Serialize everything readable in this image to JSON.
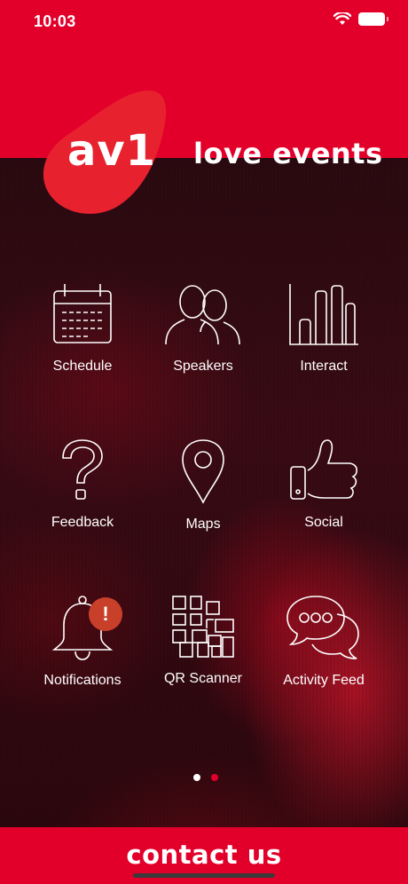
{
  "status_bar": {
    "time": "10:03"
  },
  "brand": {
    "logo_text": "av1",
    "tagline": "love events",
    "color": "#e2002b"
  },
  "menu": [
    {
      "id": "schedule",
      "label": "Schedule",
      "icon": "calendar-icon"
    },
    {
      "id": "speakers",
      "label": "Speakers",
      "icon": "people-icon"
    },
    {
      "id": "interact",
      "label": "Interact",
      "icon": "bar-chart-icon"
    },
    {
      "id": "feedback",
      "label": "Feedback",
      "icon": "question-mark-icon"
    },
    {
      "id": "maps",
      "label": "Maps",
      "icon": "map-pin-icon"
    },
    {
      "id": "social",
      "label": "Social",
      "icon": "thumbs-up-icon"
    },
    {
      "id": "notifications",
      "label": "Notifications",
      "icon": "bell-icon",
      "badge": "!"
    },
    {
      "id": "qr_scanner",
      "label": "QR Scanner",
      "icon": "qr-code-icon"
    },
    {
      "id": "activity_feed",
      "label": "Activity Feed",
      "icon": "chat-bubbles-icon"
    }
  ],
  "pagination": {
    "pages": 2,
    "current": 1
  },
  "footer": {
    "contact_label": "contact us"
  }
}
